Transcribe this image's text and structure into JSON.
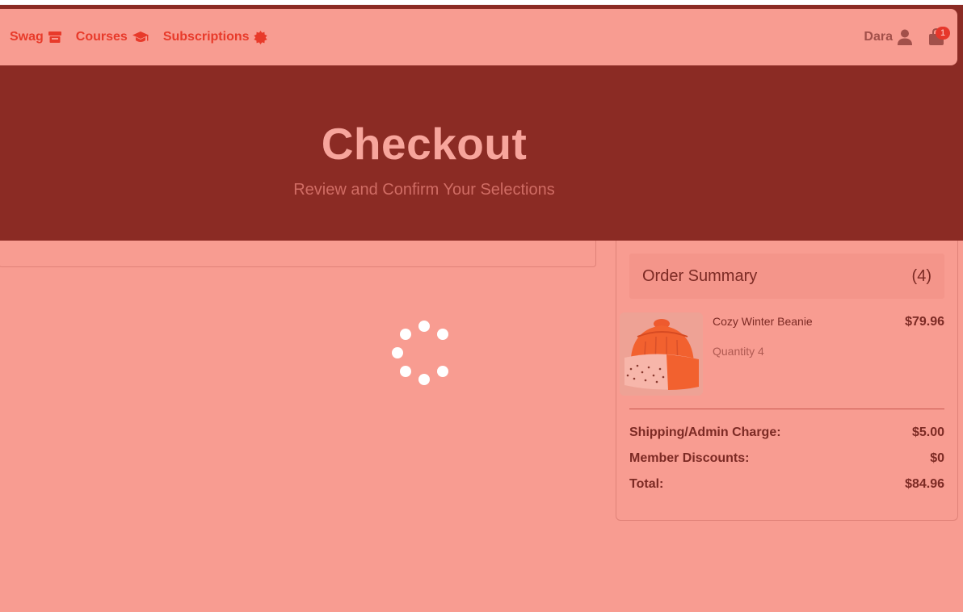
{
  "nav": {
    "links": [
      {
        "label": "Swag",
        "icon": "store-icon"
      },
      {
        "label": "Courses",
        "icon": "graduation-cap-icon"
      },
      {
        "label": "Subscriptions",
        "icon": "badge-icon"
      }
    ],
    "user_name": "Dara",
    "cart_count": "1"
  },
  "hero": {
    "title": "Checkout",
    "subtitle": "Review and Confirm Your Selections"
  },
  "summary": {
    "title": "Order Summary",
    "count": "(4)",
    "item": {
      "name": "Cozy Winter Beanie",
      "quantity": "Quantity 4",
      "price": "$79.96"
    },
    "shipping_label": "Shipping/Admin Charge:",
    "shipping_value": "$5.00",
    "discount_label": "Member Discounts:",
    "discount_value": "$0",
    "total_label": "Total:",
    "total_value": "$84.96"
  },
  "colors": {
    "accent": "#e83a2a",
    "hero_bg": "#8b2b24",
    "page_bg": "#f89c91"
  }
}
